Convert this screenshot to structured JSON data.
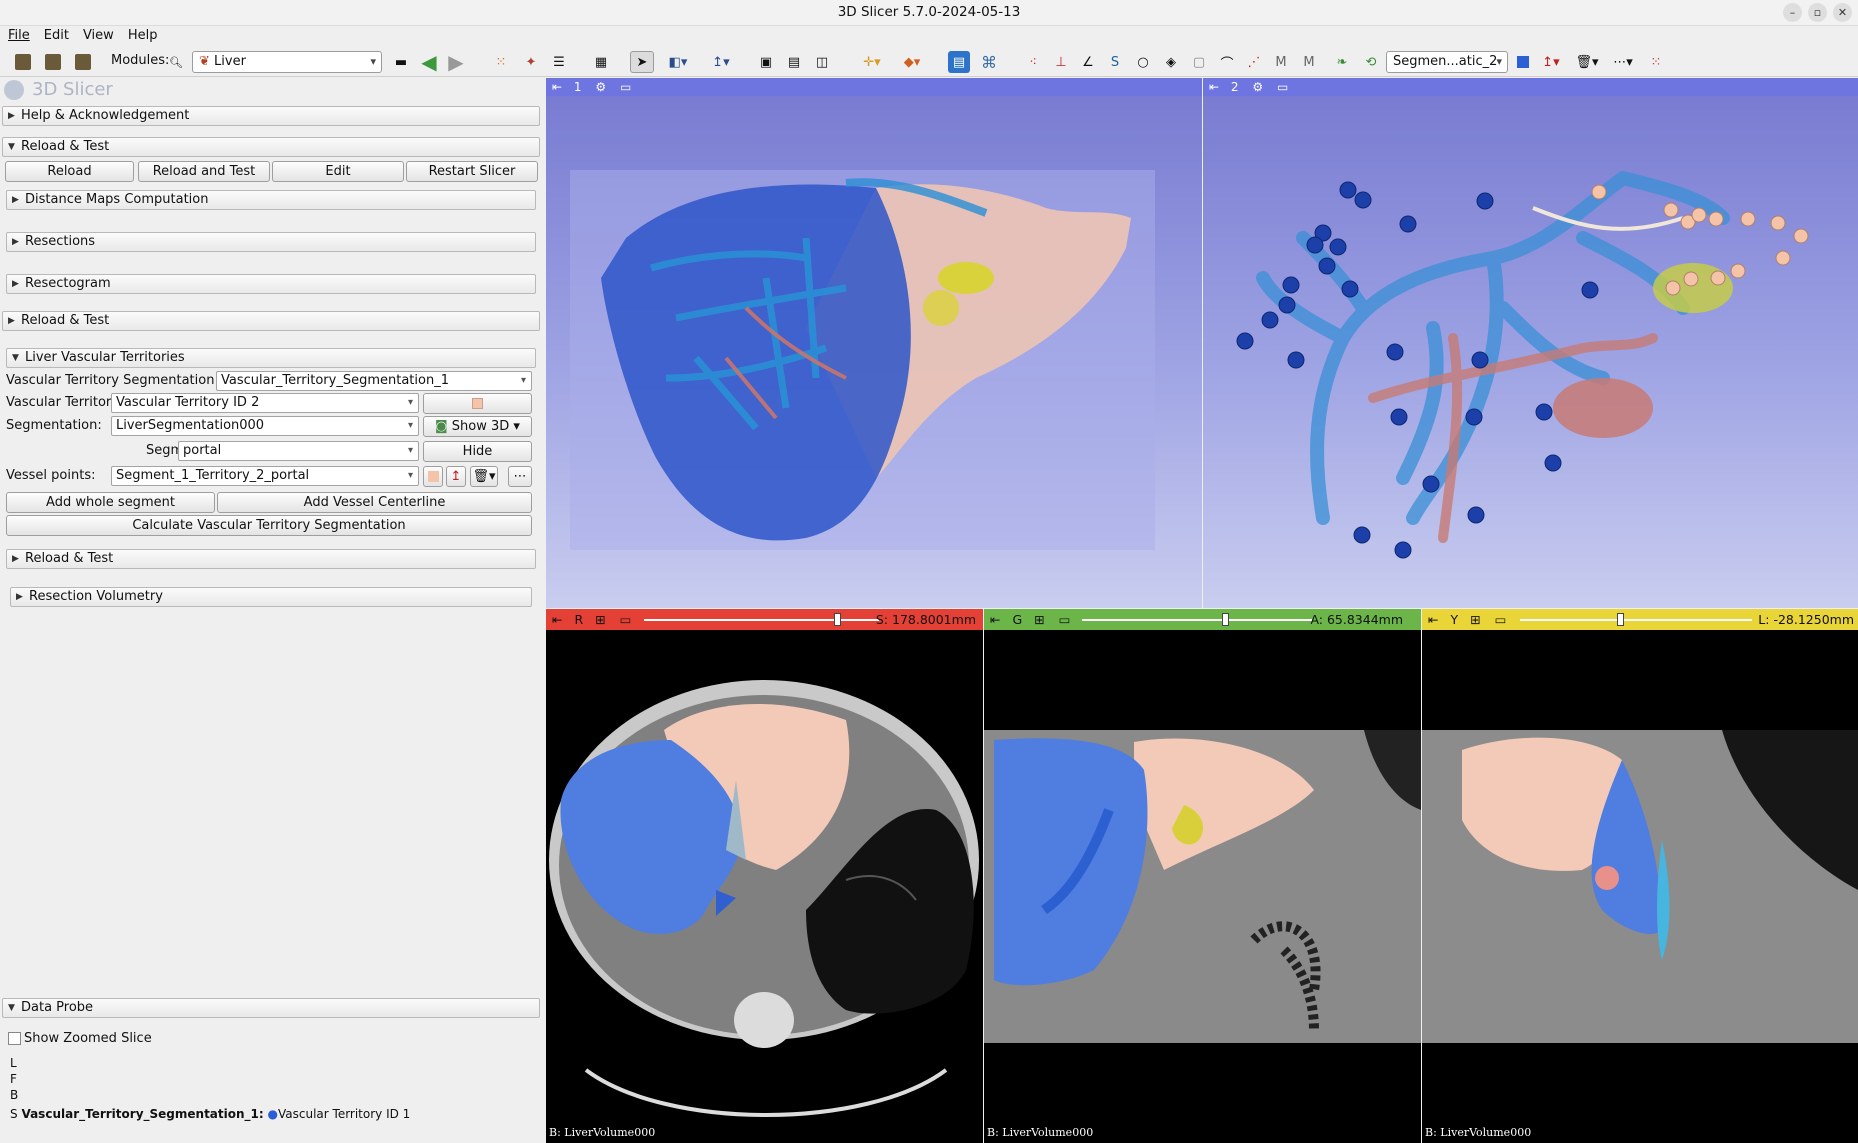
{
  "app": {
    "title": "3D Slicer 5.7.0-2024-05-13"
  },
  "menu": [
    "File",
    "Edit",
    "View",
    "Help"
  ],
  "toolbar": {
    "modules_label": "Modules:",
    "module_selected": "Liver",
    "segmentation_combo": "Segmen...atic_2"
  },
  "panel": {
    "logo": "3D Slicer",
    "help": "Help & Acknowledgement",
    "reload_test": "Reload & Test",
    "buttons": {
      "reload": "Reload",
      "reload_and_test": "Reload and Test",
      "edit": "Edit",
      "restart": "Restart Slicer"
    },
    "distance_maps": "Distance Maps Computation",
    "resections": "Resections",
    "resectogram": "Resectogram",
    "reload_test_2": "Reload & Test",
    "lvt": {
      "title": "Liver Vascular Territories",
      "vts_label": "Vascular Territory Segmentation:",
      "vts_value": "Vascular_Territory_Segmentation_1",
      "vt_label": "Vascular Territory:",
      "vt_value": "Vascular Territory ID 2",
      "vt_color": "#f4c3a8",
      "seg_label": "Segmentation:",
      "seg_value": "LiverSegmentation000",
      "show3d": "Show 3D",
      "segment_label": "Segment:",
      "segment_value": "portal",
      "hide": "Hide",
      "vp_label": "Vessel points:",
      "vp_value": "Segment_1_Territory_2_portal",
      "add_whole": "Add whole segment",
      "add_centerline": "Add Vessel Centerline",
      "calc": "Calculate Vascular Territory Segmentation"
    },
    "reload_test_3": "Reload & Test",
    "resection_volumetry": "Resection Volumetry",
    "data_probe": "Data Probe",
    "show_zoomed": "Show Zoomed Slice",
    "probe_lines": [
      "L",
      "F",
      "B"
    ],
    "probe_s_prefix": "S",
    "probe_seg_name": "Vascular_Territory_Segmentation_1:",
    "probe_seg_value": "Vascular Territory ID 1"
  },
  "views": {
    "v3d_1": "1",
    "v3d_2": "2",
    "red": {
      "letter": "R",
      "value": "S: 178.8001mm",
      "color": "#e54036",
      "pos": 0.82
    },
    "green": {
      "letter": "G",
      "value": "A: 65.8344mm",
      "color": "#6cb548",
      "pos": 0.62
    },
    "yellow": {
      "letter": "Y",
      "value": "L: -28.1250mm",
      "color": "#e9d538",
      "pos": 0.43
    },
    "bg_label": "B: LiverVolume000"
  },
  "colors": {
    "accent_blue": "#4f7de0",
    "liver_pink": "#f1c6b6",
    "territory_blue": "#3f6fd8"
  }
}
